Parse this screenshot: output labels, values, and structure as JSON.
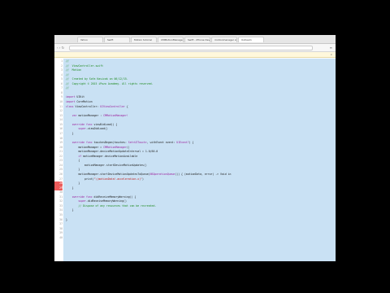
{
  "browser": {
    "tabs": [
      {
        "label": "Yahoo",
        "active": false
      },
      {
        "label": "Swift",
        "active": false
      },
      {
        "label": "Motion tutorial",
        "active": false
      },
      {
        "label": "CMMotionManager",
        "active": false
      },
      {
        "label": "Swift - iPhone Dev",
        "active": false
      },
      {
        "label": "motionmanager swift",
        "active": false
      },
      {
        "label": "Ustream",
        "active": true
      }
    ],
    "nav_icons": "‹ › ↻",
    "url": "",
    "menu_icon": "≡",
    "infobar": {
      "message": "",
      "action": "",
      "close": "×"
    }
  },
  "editor": {
    "code_lines": [
      {
        "n": "1",
        "parts": [
          {
            "t": "//",
            "c": "green"
          }
        ]
      },
      {
        "n": "2",
        "parts": [
          {
            "t": "//  ViewController.swift",
            "c": "green"
          }
        ]
      },
      {
        "n": "3",
        "parts": [
          {
            "t": "//  Motion",
            "c": "green"
          }
        ]
      },
      {
        "n": "4",
        "parts": [
          {
            "t": "//",
            "c": "green"
          }
        ]
      },
      {
        "n": "5",
        "parts": [
          {
            "t": "//  Created by Sofa Kasicak on 06/12/15.",
            "c": "green"
          }
        ]
      },
      {
        "n": "6",
        "parts": [
          {
            "t": "//  Copyright © 2015 iPozo Academy. All rights reserved.",
            "c": "green"
          }
        ]
      },
      {
        "n": "7",
        "parts": [
          {
            "t": "//",
            "c": "green"
          }
        ]
      },
      {
        "n": "8",
        "parts": []
      },
      {
        "n": "9",
        "parts": [
          {
            "t": "import",
            "c": "purple"
          },
          {
            "t": " UIKit",
            "c": "dark"
          }
        ]
      },
      {
        "n": "10",
        "parts": [
          {
            "t": "import",
            "c": "purple"
          },
          {
            "t": " CoreMotion",
            "c": "dark"
          }
        ]
      },
      {
        "n": "11",
        "parts": [
          {
            "t": "class",
            "c": "purple"
          },
          {
            "t": " ViewController: ",
            "c": "dark"
          },
          {
            "t": "UIViewController",
            "c": "purple"
          },
          {
            "t": " {",
            "c": "dark"
          }
        ]
      },
      {
        "n": "12",
        "parts": []
      },
      {
        "n": "13",
        "parts": [
          {
            "t": "    ",
            "c": "dark"
          },
          {
            "t": "var",
            "c": "purple"
          },
          {
            "t": " motionManager : ",
            "c": "dark"
          },
          {
            "t": "CMMotionManager!",
            "c": "purple"
          }
        ]
      },
      {
        "n": "14",
        "parts": []
      },
      {
        "n": "15",
        "parts": [
          {
            "t": "    ",
            "c": "dark"
          },
          {
            "t": "override func",
            "c": "purple"
          },
          {
            "t": " viewDidLoad() {",
            "c": "dark"
          }
        ]
      },
      {
        "n": "16",
        "parts": [
          {
            "t": "        ",
            "c": "dark"
          },
          {
            "t": "super",
            "c": "purple"
          },
          {
            "t": ".viewDidLoad()",
            "c": "dark"
          }
        ]
      },
      {
        "n": "17",
        "parts": [
          {
            "t": "    }",
            "c": "dark"
          }
        ]
      },
      {
        "n": "18",
        "parts": []
      },
      {
        "n": "19",
        "parts": [
          {
            "t": "    ",
            "c": "dark"
          },
          {
            "t": "override func",
            "c": "purple"
          },
          {
            "t": " touchesBegan(touches: ",
            "c": "dark"
          },
          {
            "t": "Set<UITouch>",
            "c": "purple"
          },
          {
            "t": ", withEvent event: ",
            "c": "dark"
          },
          {
            "t": "UIEvent?",
            "c": "purple"
          },
          {
            "t": ") {",
            "c": "dark"
          }
        ]
      },
      {
        "n": "20",
        "parts": [
          {
            "t": "        motionManager = ",
            "c": "dark"
          },
          {
            "t": "CMMotionManager",
            "c": "purple"
          },
          {
            "t": "()",
            "c": "dark"
          }
        ]
      },
      {
        "n": "21",
        "parts": [
          {
            "t": "        motionManager.deviceMotionUpdateInterval = 1.0/60.0",
            "c": "dark"
          }
        ]
      },
      {
        "n": "22",
        "parts": [
          {
            "t": "        ",
            "c": "dark"
          },
          {
            "t": "if",
            "c": "purple"
          },
          {
            "t": " motionManager.deviceMotionAvailable",
            "c": "dark"
          }
        ]
      },
      {
        "n": "23",
        "parts": [
          {
            "t": "        {",
            "c": "dark"
          }
        ]
      },
      {
        "n": "24",
        "parts": [
          {
            "t": "            motionManager.startDeviceMotionUpdates()",
            "c": "dark"
          }
        ]
      },
      {
        "n": "25",
        "parts": [
          {
            "t": "        }",
            "c": "dark"
          }
        ]
      },
      {
        "n": "26",
        "parts": [
          {
            "t": "        motionManager.startDeviceMotionUpdatesToQueue(",
            "c": "dark"
          },
          {
            "t": "NSOperationQueue",
            "c": "purple"
          },
          {
            "t": "()) { (motionData, error) -> Void in",
            "c": "dark"
          }
        ]
      },
      {
        "n": "27",
        "parts": [
          {
            "t": "            print(",
            "c": "dark"
          },
          {
            "t": "\"\\(motionData!.acceleration.x)\"",
            "c": "red"
          },
          {
            "t": ")",
            "c": "dark"
          }
        ]
      },
      {
        "n": "28",
        "parts": [
          {
            "t": "        }",
            "c": "dark"
          }
        ]
      },
      {
        "n": "29",
        "parts": [
          {
            "t": "    }",
            "c": "dark"
          }
        ]
      },
      {
        "n": "30",
        "parts": []
      },
      {
        "n": "31",
        "parts": [
          {
            "t": "    ",
            "c": "dark"
          },
          {
            "t": "override func",
            "c": "purple"
          },
          {
            "t": " didReceiveMemoryWarning() {",
            "c": "dark"
          }
        ]
      },
      {
        "n": "32",
        "parts": [
          {
            "t": "        ",
            "c": "dark"
          },
          {
            "t": "super",
            "c": "purple"
          },
          {
            "t": ".didReceiveMemoryWarning()",
            "c": "dark"
          }
        ]
      },
      {
        "n": "33",
        "parts": [
          {
            "t": "        // Dispose of any resources that can be recreated.",
            "c": "green"
          }
        ]
      },
      {
        "n": "34",
        "parts": [
          {
            "t": "    }",
            "c": "dark"
          }
        ]
      },
      {
        "n": "35",
        "parts": []
      },
      {
        "n": "36",
        "parts": [
          {
            "t": "}",
            "c": "dark"
          }
        ]
      },
      {
        "n": "37",
        "parts": []
      },
      {
        "n": "38",
        "parts": []
      },
      {
        "n": "39",
        "parts": []
      },
      {
        "n": "40",
        "parts": []
      }
    ],
    "breakpoint_lines": [
      28,
      29
    ],
    "colors": {
      "comment": "#1f8a1f",
      "keyword": "#9a1c9a",
      "string": "#c41a16",
      "selection": "#c9e1f4",
      "breakpoint": "#ea5a5a"
    }
  }
}
